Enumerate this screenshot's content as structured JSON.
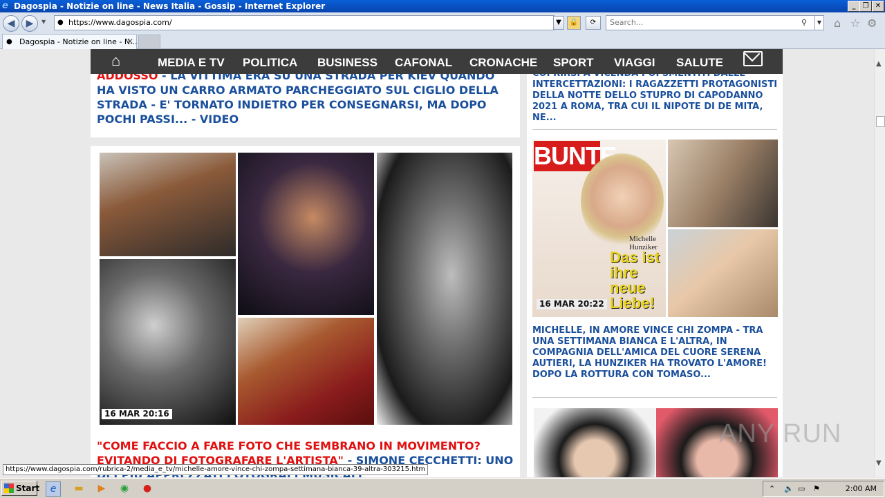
{
  "window": {
    "title": "Dagospia - Notizie on line - News Italia - Gossip - Internet Explorer",
    "minimize": "_",
    "restore": "❐",
    "close": "✕"
  },
  "addressbar": {
    "url": "https://www.dagospia.com/",
    "search_placeholder": "Search..."
  },
  "tabs": [
    {
      "label": "Dagospia - Notizie on line - N...",
      "close": "✕"
    }
  ],
  "nav": {
    "items": [
      "MEDIA E TV",
      "POLITICA",
      "BUSINESS",
      "CAFONAL",
      "CRONACHE",
      "SPORT",
      "VIAGGI",
      "SALUTE"
    ]
  },
  "left": {
    "headline1_red": "ADDOSSO",
    "headline1_blue": " - LA VITTIMA ERA SU UNA STRADA PER KIEV QUANDO HA VISTO UN CARRO ARMATO PARCHEGGIATO SUL CIGLIO DELLA STRADA - E' TORNATO INDIETRO PER CONSEGNARSI, MA DOPO POCHI PASSI... - VIDEO",
    "timestamp": "16 MAR 20:16",
    "caption_red": "\"COME FACCIO A FARE FOTO CHE SEMBRANO IN MOVIMENTO? EVITANDO DI FOTOGRAFARE L'ARTISTA\"",
    "caption_blue": " - SIMONE CECCHETTI: UNO DEI PIÙ APPREZZATI FOTOGRAFI MUSICALI"
  },
  "right": {
    "headline1": "COPRIRSI A VICENDA POI SMENTITI DALLE INTERCETTAZIONI: I RAGAZZETTI PROTAGONISTI DELLA NOTTE DELLO STUPRO DI CAPODANNO 2021 A ROMA, TRA CUI IL NIPOTE DI DE MITA, NE...",
    "cover_logo": "BUNTE",
    "cover_name": "Michelle Hunziker",
    "cover_big": "Das ist ihre neue Liebe!",
    "timestamp": "16 MAR 20:22",
    "headline2": "MICHELLE, IN AMORE VINCE CHI ZOMPA - TRA UNA SETTIMANA BIANCA E L'ALTRA, IN COMPAGNIA DELL'AMICA DEL CUORE SERENA AUTIERI, LA HUNZIKER HA TROVATO L'AMORE! DOPO LA ROTTURA CON TOMASO..."
  },
  "status_link": "https://www.dagospia.com/rubrica-2/media_e_tv/michelle-amore-vince-chi-zompa-settimana-bianca-39-altra-303215.htm",
  "watermark": "ANY RUN",
  "taskbar": {
    "start": "Start",
    "clock": "2:00 AM"
  }
}
